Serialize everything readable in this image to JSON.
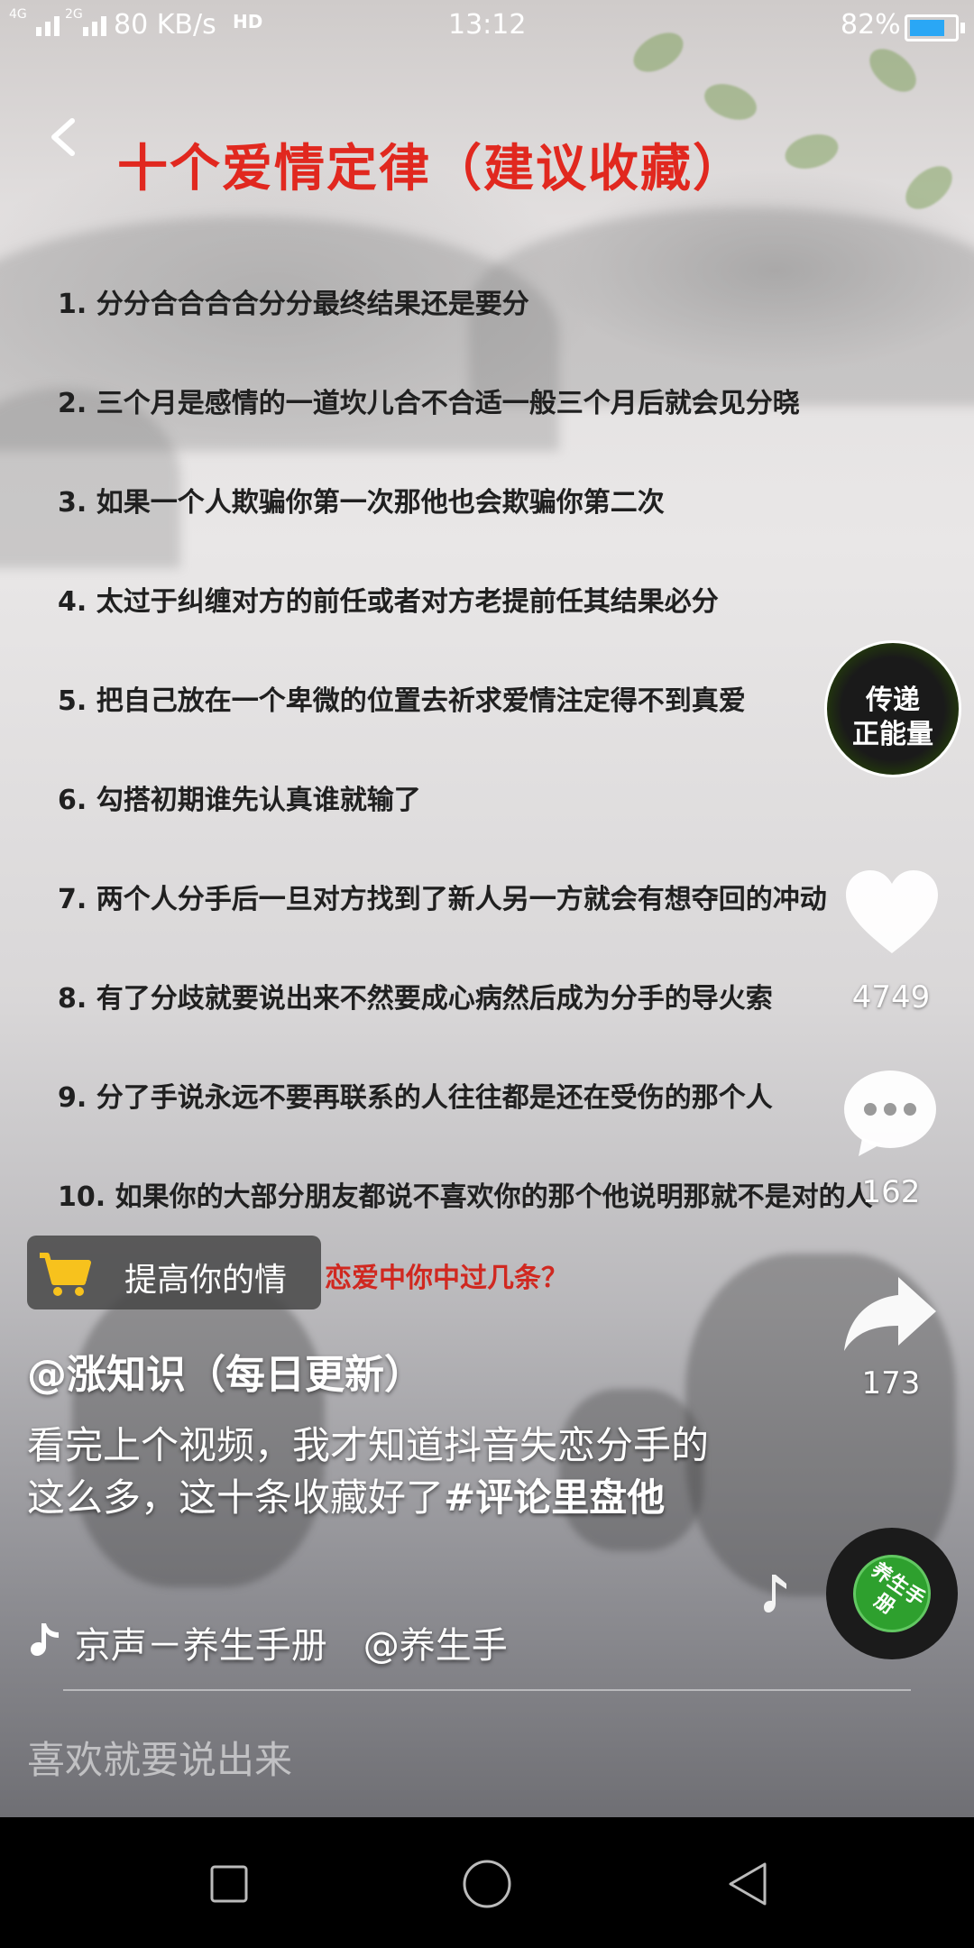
{
  "status_bar": {
    "network_1": "4G",
    "network_2": "2G",
    "speed": "80 KB/s",
    "hd": "HD",
    "time": "13:12",
    "battery": "82%",
    "battery_level": 0.82
  },
  "video": {
    "title": "十个爱情定律（建议收藏）",
    "rules": [
      "1. 分分合合合合分分最终结果还是要分",
      "2. 三个月是感情的一道坎儿合不合适一般三个月后就会见分晓",
      "3. 如果一个人欺骗你第一次那他也会欺骗你第二次",
      "4. 太过于纠缠对方的前任或者对方老提前任其结果必分",
      "5. 把自己放在一个卑微的位置去祈求爱情注定得不到真爱",
      "6. 勾搭初期谁先认真谁就输了",
      "7. 两个人分手后一旦对方找到了新人另一方就会有想夺回的冲动",
      "8. 有了分歧就要说出来不然要成心病然后成为分手的导火索",
      "9. 分了手说永远不要再联系的人往往都是还在受伤的那个人",
      "10. 如果你的大部分朋友都说不喜欢你的那个他说明那就不是对的人"
    ],
    "question": "恋爱中你中过几条？"
  },
  "sidebar": {
    "badge_line1": "传递",
    "badge_line2": "正能量",
    "likes": "4749",
    "comments": "162",
    "shares": "173",
    "disc_text": "养生手册"
  },
  "shop": {
    "label": "提高你的情"
  },
  "post": {
    "author": "@涨知识（每日更新）",
    "description": "看完上个视频，我才知道抖音失恋分手的这么多，这十条收藏好了",
    "hashtag": "#评论里盘他",
    "music": "京声－养生手册　@养生手"
  },
  "comment_input": {
    "placeholder": "喜欢就要说出来"
  },
  "colors": {
    "title_red": "#e1281f",
    "battery_blue": "#2aa7f5",
    "disc_green": "#2ea02e"
  }
}
